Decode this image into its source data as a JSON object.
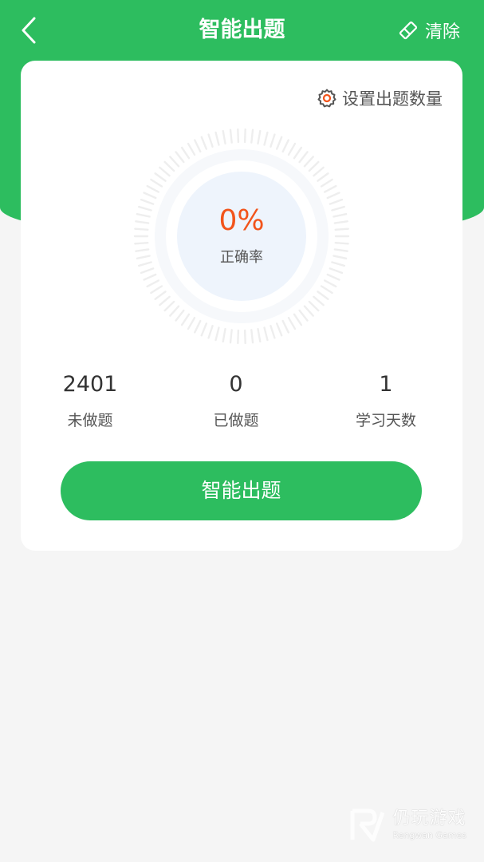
{
  "header": {
    "title": "智能出题",
    "clear_label": "清除"
  },
  "card": {
    "settings_label": "设置出题数量",
    "accuracy": {
      "value": "0%",
      "label": "正确率"
    },
    "stats": [
      {
        "value": "2401",
        "label": "未做题"
      },
      {
        "value": "0",
        "label": "已做题"
      },
      {
        "value": "1",
        "label": "学习天数"
      }
    ],
    "start_button_label": "智能出题"
  },
  "watermark": {
    "name_cn": "仍玩游戏",
    "name_en": "Rengwan Games"
  },
  "colors": {
    "brand_green": "#2dbd5f",
    "accent_orange": "#f2541b",
    "settings_icon_orange": "#f2541b"
  },
  "icons": {
    "back": "chevron-left-icon",
    "clear": "eraser-icon",
    "settings": "gear-icon"
  }
}
